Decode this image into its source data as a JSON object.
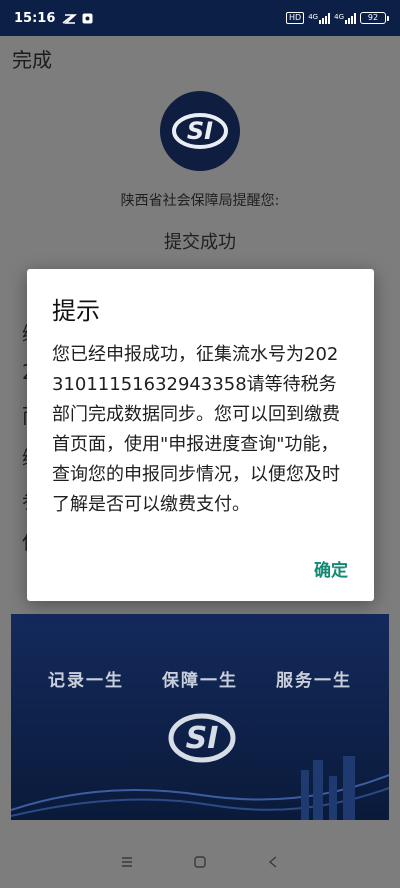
{
  "status_bar": {
    "time": "15:16",
    "hd": "HD",
    "net1": "4G",
    "net2": "4G",
    "battery": "92"
  },
  "header": {
    "done_label": "完成"
  },
  "page": {
    "reminder": "陕西省社会保障局提醒您:",
    "status_title": "提交成功",
    "hidden_row_initials": [
      "缴",
      "2",
      "而",
      "缴",
      "参",
      "保"
    ]
  },
  "banner": {
    "slogans": [
      "记录一生",
      "保障一生",
      "服务一生"
    ]
  },
  "dialog": {
    "title": "提示",
    "message": "您已经申报成功，征集流水号为20231011151632943358请等待税务部门完成数据同步。您可以回到缴费首页面，使用\"申报进度查询\"功能，查询您的申报同步情况，以便您及时了解是否可以缴费支付。",
    "confirm_label": "确定"
  },
  "colors": {
    "status_bar_bg": "#0b1f47",
    "dim_overlay": "#7d7d7d",
    "accent": "#138a72",
    "logo_bg": "#0e1d40"
  },
  "icons": {
    "nav": [
      "menu-icon",
      "home-icon",
      "back-icon"
    ],
    "logo": "si-logo-icon"
  }
}
